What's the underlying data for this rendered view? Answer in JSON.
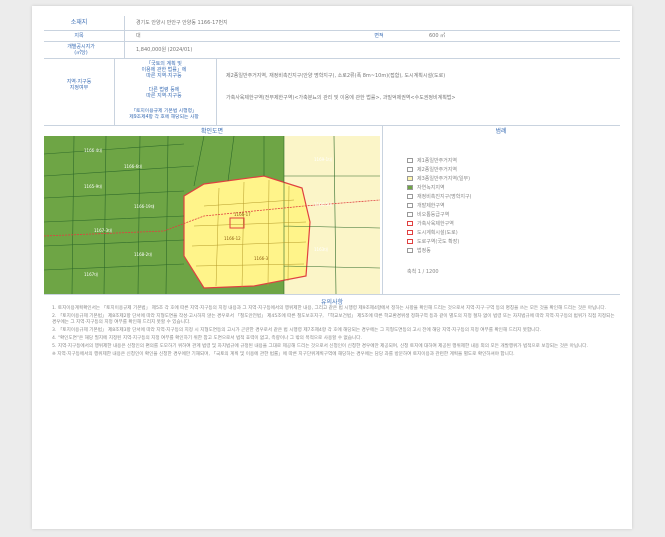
{
  "header": {
    "location_label": "소재지",
    "location_value": "경기도 안양시 만안구 안양동 1166-17번지"
  },
  "info": {
    "land_category_label": "지목",
    "land_category_value": "대",
    "area_label": "면적",
    "area_value": "600 ㎡",
    "official_price_label": "개별공시지가\n(㎡당)",
    "official_price_value": "1,840,000원 (2024/01)"
  },
  "zoning": {
    "section_label": "지역·지구등\n지정여부",
    "national_act_label": "「국토의 계획 및\n이용에 관한 법률」에\n따른 지역·지구등",
    "national_act_value": "제2종일반주거지역, 재정비촉진지구(안양 명학지구), 소로2류(폭 8m~10m)(접함), 도시계획시설(도로)",
    "other_act_label": "다른 법령 등에\n따른 지역·지구등",
    "other_act_value": "가축사육제한구역(전부제한구역)<가축분뇨의 관리 및 이용에 관한 법률>, 과밀억제권역<수도권정비계획법>",
    "regulation_label": "「토지이용규제 기본법 시행령」\n제9조제4항 각 호에 해당되는 사항"
  },
  "map": {
    "title": "확인도면",
    "parcels": [
      "1166-17",
      "1166-12",
      "1166-3",
      "1166-4대",
      "1166-6대",
      "1165-9대",
      "1166-19대",
      "1167-3대",
      "1168-2대",
      "1167대",
      "1169-1대",
      "1164-5대",
      "1163대"
    ]
  },
  "legend": {
    "title": "범례",
    "items": [
      {
        "label": "제1종일반주거지역",
        "color": "#ffffff"
      },
      {
        "label": "제2종일반주거지역",
        "color": "#ffffff"
      },
      {
        "label": "제3종일반주거지역(일부)",
        "color": "#fff7b0"
      },
      {
        "label": "자연녹지지역",
        "color": "#6ea545"
      },
      {
        "label": "재정비촉진지구(명학지구)",
        "color": "#ffffff"
      },
      {
        "label": "개발제한구역",
        "color": "#ffffff"
      },
      {
        "label": "비오톱등급구역",
        "color": "#ffffff"
      },
      {
        "label": "가축사육제한구역",
        "color": "#ffffff"
      },
      {
        "label": "도시계획시설(도로)",
        "color": "#ffffff"
      },
      {
        "label": "도로구역(국도 확장)",
        "color": "#ffffff"
      },
      {
        "label": "법정동",
        "color": "#ffffff"
      }
    ],
    "scale": "축척 1 / 1200"
  },
  "notes": {
    "title": "유의사항",
    "paragraphs": [
      "1. 토지이용계획확인서는 「토지이용규제 기본법」 제5조 각 호에 따른 지역·지구등의 지정 내용과 그 지역·지구등에서의 행위제한 내용, 그리고 같은 법 시행령 제9조제4항에서 정하는 사항을 확인해 드리는 것으로서 지역·지구·구역 등의 명칭을 쓰는 모든 것을 확인해 드리는 것은 아닙니다.",
      "2. 「토지이용규제 기본법」 제8조제2항 단서에 따라 지형도면을 작성·고시하지 않는 경우로서 「철도안전법」 제45조에 따른 철도보호지구, 「학교보건법」 제5조에 따른 학교환경위생 정화구역 등과 같이 별도의 지정 절차 없이 법령 또는 자치법규에 따라 지역·지구등의 범위가 직접 지정되는 경우에는 그 지역·지구등의 지정 여부를 확인해 드리지 못할 수 있습니다.",
      "3. 「토지이용규제 기본법」 제8조제3항 단서에 따라 지역·지구등의 지정 시 지형도면등의 고시가 곤란한 경우로서 같은 법 시행령 제7조제4항 각 호에 해당되는 경우에는 그 지형도면등의 고시 전에 해당 지역·지구등의 지정 여부를 확인해 드리지 못합니다.",
      "4. \"확인도면\"은 해당 필지에 지정된 지역·지구등의 지정 여부를 확인하기 위한 참고 도면으로서 법적 효력이 없고, 측량이나 그 밖의 목적으로 사용할 수 없습니다.",
      "5. 지역·지구등에서의 행위제한 내용은 신청인의 편의를 도모하기 위하여 관계 법령 및 자치법규에 규정된 내용을 그대로 제공해 드리는 것으로서 신청인이 신청한 경우에만 제공되며, 신청 토지에 대하여 제공된 행위제한 내용 외의 모든 개발행위가 법적으로 보장되는 것은 아닙니다.",
      "※ 지역·지구등에서의 행위제한 내용은 신청인이 확인을 신청한 경우에만 기재되며, 「국토의 계획 및 이용에 관한 법률」에 따른 지구단위계획구역에 해당하는 경우에는 담당 과를 방문하여 토지이용과 관련한 계획을 별도로 확인하셔야 합니다."
    ]
  }
}
